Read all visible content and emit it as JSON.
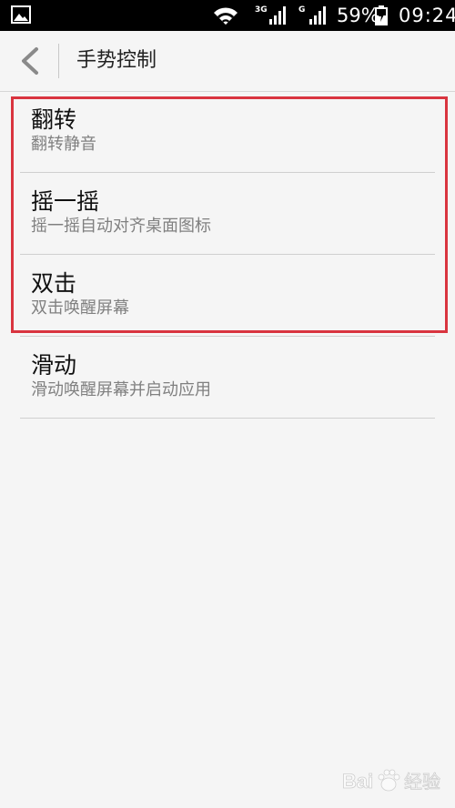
{
  "status_bar": {
    "network_3g": "3G",
    "network_g": "G",
    "battery": "59%",
    "time": "09:24",
    "icons": [
      "gallery-icon",
      "wifi-icon",
      "signal-icon",
      "battery-icon"
    ]
  },
  "action_bar": {
    "title": "手势控制",
    "back_icon": "chevron-left-icon"
  },
  "settings": [
    {
      "title": "翻转",
      "subtitle": "翻转静音"
    },
    {
      "title": "摇一摇",
      "subtitle": "摇一摇自动对齐桌面图标"
    },
    {
      "title": "双击",
      "subtitle": "双击唤醒屏幕"
    },
    {
      "title": "滑动",
      "subtitle": "滑动唤醒屏幕并启动应用"
    }
  ],
  "colors": {
    "highlight": "#d9343f",
    "background": "#f5f5f5",
    "status_bar": "#000000"
  }
}
